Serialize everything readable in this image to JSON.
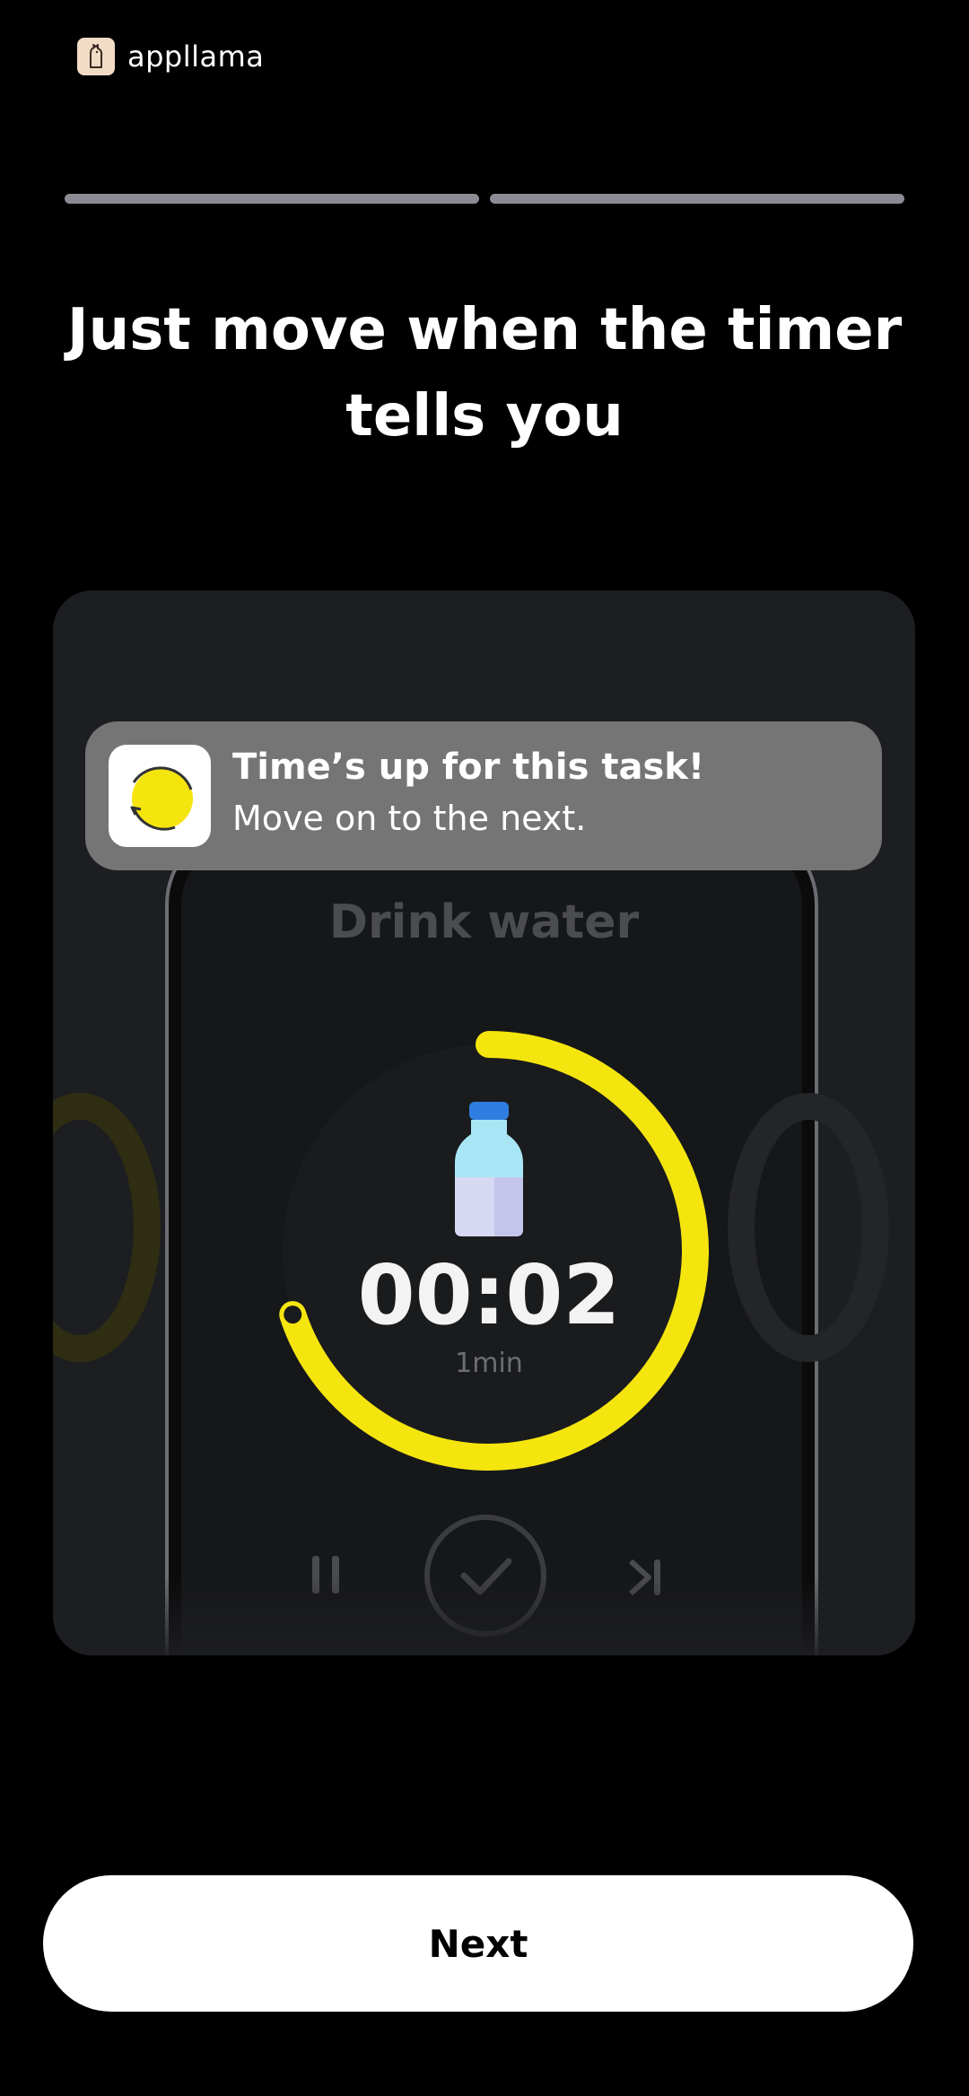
{
  "brand": {
    "name": "appllama",
    "icon": "llama-logo-icon"
  },
  "onboarding": {
    "steps_total": 2,
    "steps_completed": 2,
    "headline": "Just move when the timer tells you"
  },
  "notification": {
    "app_icon": "timer-app-icon",
    "title": "Time’s up for this task!",
    "body": "Move on to the next."
  },
  "task_screen": {
    "task_name": "Drink water",
    "task_icon": "water-bottle-icon",
    "time_display": "00:02",
    "duration_label": "1min",
    "timer_progress_fraction": 0.7,
    "controls": {
      "pause_icon": "pause-icon",
      "done_icon": "checkmark-icon",
      "skip_icon": "skip-next-icon"
    }
  },
  "actions": {
    "next_label": "Next"
  },
  "colors": {
    "background": "#000000",
    "card": "#1d1e21",
    "accent_yellow": "#f5e50f",
    "notification_bg": "#757575",
    "button_bg": "#ffffff",
    "progress_segment": "#8b8b93"
  }
}
